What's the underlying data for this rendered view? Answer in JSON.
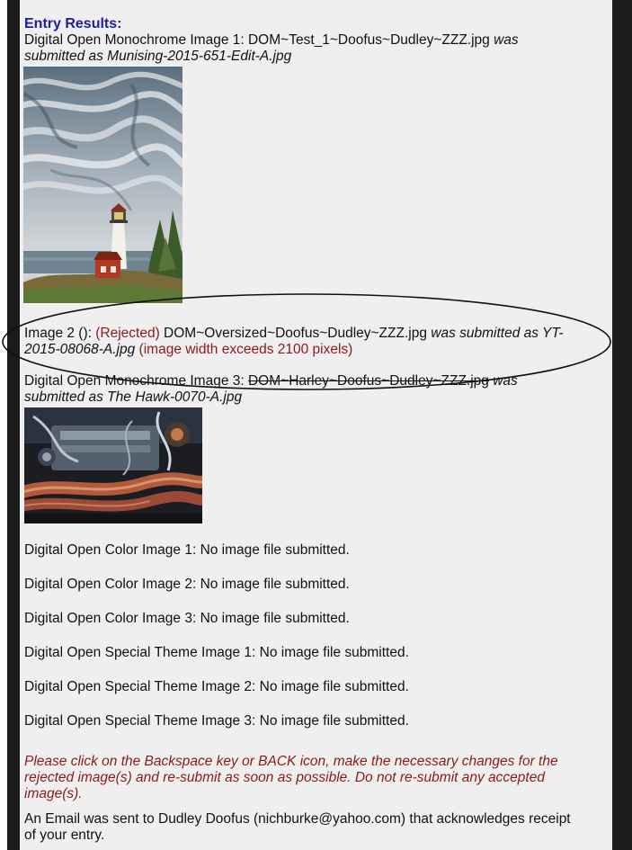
{
  "heading": "Entry Results:",
  "entry1": {
    "prefix": "Digital Open Monochrome Image 1: DOM~Test_1~Doofus~Dudley~ZZZ.jpg ",
    "was": "was",
    "submitted_as": "submitted as Munising-2015-651-Edit-A.jpg"
  },
  "entry2": {
    "label": "Image 2 (): ",
    "rejected": "(Rejected)",
    "filename": " DOM~Oversized~Doofus~Dudley~ZZZ.jpg ",
    "was_submitted": "was submitted as YT-",
    "submitted_cont": "2015-08068-A.jpg",
    "error": " (image width exceeds 2100 pixels)"
  },
  "entry3": {
    "label": "Digital Open Monochrome Image 3: ",
    "filename": "DOM~Harley~Doofus~Dudley~ZZZ.jpg",
    "was": " was",
    "submitted_as": "submitted as The Hawk-0070-A.jpg"
  },
  "status_lines": [
    "Digital Open Color Image 1: No image file submitted.",
    "Digital Open Color Image 2: No image file submitted.",
    "Digital Open Color Image 3: No image file submitted.",
    "Digital Open Special Theme Image 1: No image file submitted.",
    "Digital Open Special Theme Image 2: No image file submitted.",
    "Digital Open Special Theme Image 3: No image file submitted."
  ],
  "notice": [
    "Please click on the Backspace key or BACK icon, make the necessary changes for the",
    "rejected image(s) and re-submit as soon as possible. Do not re-submit any accepted",
    "image(s)."
  ],
  "email": [
    "An Email was sent to Dudley Doofus (nichburke@yahoo.com) that acknowledges receipt",
    "of your entry."
  ],
  "colors": {
    "heading": "#1e1e9e",
    "rejected": "#8b1a1a",
    "page_bg": "#efefef",
    "side_bars": "#1c1c1c"
  }
}
